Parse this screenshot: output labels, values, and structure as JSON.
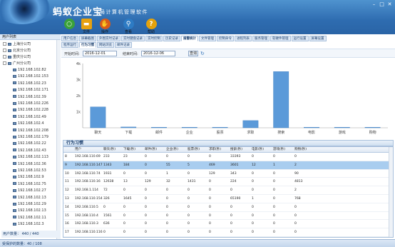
{
  "app": {
    "logo": "蚂蚁企业宝",
    "subtitle": "局计算机管理软件"
  },
  "window_controls": [
    "–",
    "□",
    "✕"
  ],
  "toolbar": [
    {
      "label": "",
      "icon": "start-icon",
      "color": "#3aa13a"
    },
    {
      "label": "文件",
      "icon": "folder-icon",
      "color": "#e7a10f"
    },
    {
      "label": "操作",
      "icon": "hand-icon",
      "color": "#d95b1a"
    },
    {
      "label": "查看",
      "icon": "magnifier-icon",
      "color": "#2d7bc4"
    },
    {
      "label": "帮助",
      "icon": "help-icon",
      "color": "#e4a20c"
    }
  ],
  "sidebar": {
    "header": "用户列表",
    "groups": [
      "上海分公司",
      "北京分公司",
      "重庆分公司",
      "广州分公司"
    ],
    "hosts": [
      "192.168.102.82",
      "192.168.102.153",
      "192.168.102.23",
      "192.168.102.171",
      "192.168.102.39",
      "192.168.102.226",
      "192.168.102.228",
      "192.168.102.49",
      "192.168.102.4",
      "192.168.102.208",
      "192.168.102.179",
      "192.168.102.22",
      "192.168.102.43",
      "192.168.102.113",
      "192.168.102.36",
      "192.168.102.53",
      "192.168.102.9",
      "192.168.102.75",
      "192.168.102.27",
      "192.168.102.13",
      "192.168.102.29",
      "192.168.102.13",
      "192.168.102.11",
      "192.168.102.3"
    ],
    "footer": "用户数量：  440 / 440"
  },
  "tabs1": [
    "用户信息",
    "屏幕截图",
    "外围实时记录",
    "实时键盘记录",
    "实时控制",
    "历史记录",
    "报警统计",
    "文件管理",
    "控制命令",
    "进程列表",
    "服务管理",
    "软硬件管理",
    "运行设置",
    "屏幕设置"
  ],
  "tabs1_active": 6,
  "tabs2": [
    "程序运行",
    "行为习惯",
    "网站浏览",
    "邮件记录"
  ],
  "tabs2_active": 1,
  "datebar": {
    "start_label": "开始时间:",
    "start_value": "2016-12-01",
    "end_label": "结束时间:",
    "end_value": "2016-12-06",
    "query_label": "查询"
  },
  "chart_data": {
    "type": "bar",
    "categories": [
      "聊天",
      "下载",
      "邮件",
      "企业",
      "股票",
      "求职",
      "搜索",
      "电影",
      "游戏",
      "购物"
    ],
    "values": [
      1.3,
      0.05,
      0.03,
      0.02,
      0.03,
      0.45,
      3.5,
      0.02,
      0.02,
      0.02
    ],
    "y_ticks": [
      "4k",
      "3k",
      "2k",
      "1k",
      ""
    ],
    "ylim": [
      0,
      4
    ],
    "bar_color": "#5b9ad9"
  },
  "grid": {
    "title": "行为习惯",
    "columns": [
      "",
      "用户",
      "聊天(秒)",
      "下载(秒)",
      "邮件(秒)",
      "企业(秒)",
      "股票(秒)",
      "求职(秒)",
      "搜索(秒)",
      "电影(秒)",
      "游戏(秒)",
      "购物(秒)"
    ],
    "rows": [
      [
        "8",
        "192.168.110.69",
        "233",
        "23",
        "0",
        "0",
        "0",
        "0",
        "33393",
        "0",
        "0",
        "0"
      ],
      [
        "9",
        "192.168.110.147",
        "1343",
        "184",
        "0",
        "55",
        "5",
        "469",
        "3601",
        "12",
        "1",
        "2"
      ],
      [
        "10",
        "192.168.110.74",
        "1931",
        "0",
        "0",
        "1",
        "0",
        "129",
        "343",
        "0",
        "0",
        "90"
      ],
      [
        "11",
        "192.168.110.16",
        "12638",
        "13",
        "129",
        "32",
        "1431",
        "0",
        "224",
        "0",
        "0",
        "4813"
      ],
      [
        "12",
        "192.168.1.114",
        "72",
        "0",
        "0",
        "0",
        "0",
        "0",
        "0",
        "0",
        "0",
        "2"
      ],
      [
        "13",
        "192.168.110.154",
        "326",
        "1645",
        "0",
        "0",
        "0",
        "0",
        "65190",
        "1",
        "0",
        "768"
      ],
      [
        "14",
        "192.168.110.5",
        "0",
        "0",
        "0",
        "0",
        "0",
        "0",
        "0",
        "0",
        "0",
        "0"
      ],
      [
        "15",
        "192.168.110.4",
        "1561",
        "0",
        "0",
        "0",
        "0",
        "0",
        "0",
        "0",
        "0",
        "0"
      ],
      [
        "16",
        "192.168.110.3",
        "636",
        "0",
        "0",
        "0",
        "0",
        "0",
        "0",
        "0",
        "0",
        "0"
      ],
      [
        "17",
        "192.168.110.116",
        "0",
        "0",
        "0",
        "0",
        "0",
        "0",
        "0",
        "0",
        "0",
        "0"
      ]
    ],
    "selected_row": 1
  },
  "status": {
    "text": "受保护的数量：40 / 108"
  }
}
